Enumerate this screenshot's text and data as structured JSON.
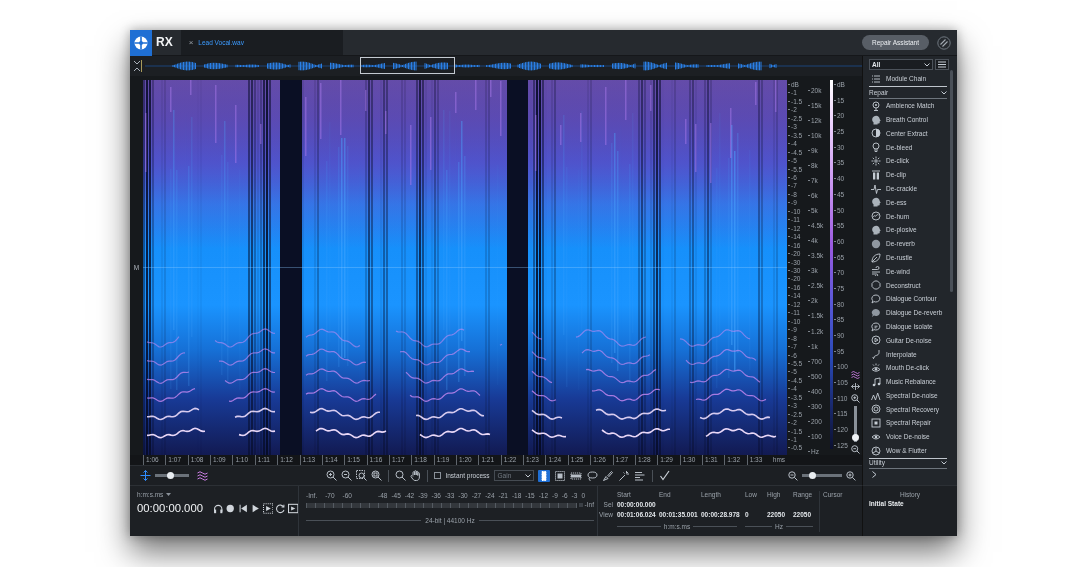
{
  "app": {
    "logo_text": "RX"
  },
  "file_tab": {
    "close_glyph": "×",
    "title": "Lead Vocal.wav",
    "selected": true
  },
  "repair_assistant": {
    "label": "Repair Assistant"
  },
  "spectrogram": {
    "channel_label": "M",
    "amplitude_scale": [
      "dB",
      "-1",
      "-1.5",
      "-2",
      "-2.5",
      "-3",
      "-3.5",
      "-4",
      "-4.5",
      "-5",
      "-5.5",
      "-6",
      "-7",
      "-8",
      "-9",
      "-10",
      "-11",
      "-12",
      "-14",
      "-16",
      "-20",
      "-30",
      "-30",
      "-20",
      "-16",
      "-14",
      "-12",
      "-11",
      "-10",
      "-9",
      "-8",
      "-7",
      "-6",
      "-5.5",
      "-5",
      "-4.5",
      "-4",
      "-3.5",
      "-3",
      "-2.5",
      "-2",
      "-1.5",
      "-1",
      "-0.5"
    ],
    "frequency_scale": [
      "20k",
      "15k",
      "12k",
      "10k",
      "9k",
      "8k",
      "7k",
      "6k",
      "5k",
      "4.5k",
      "4k",
      "3.5k",
      "3k",
      "2.5k",
      "2k",
      "1.5k",
      "1.2k",
      "1k",
      "700",
      "500",
      "400",
      "300",
      "200",
      "100",
      "Hz"
    ],
    "color_scale": [
      "dB",
      "15",
      "20",
      "25",
      "30",
      "35",
      "40",
      "45",
      "50",
      "55",
      "60",
      "65",
      "70",
      "75",
      "80",
      "85",
      "90",
      "95",
      "100",
      "105",
      "110",
      "115",
      "120",
      "125"
    ],
    "time_axis": [
      "1:06",
      "1:07",
      "1:08",
      "1:09",
      "1:10",
      "1:11",
      "1:12",
      "1:13",
      "1:14",
      "1:15",
      "1:16",
      "1:17",
      "1:18",
      "1:19",
      "1:20",
      "1:21",
      "1:22",
      "1:23",
      "1:24",
      "1:25",
      "1:26",
      "1:27",
      "1:28",
      "1:29",
      "1:30",
      "1:31",
      "1:32",
      "1:33"
    ],
    "time_unit": "hms"
  },
  "view_controls": {
    "display_slider": {
      "level": 0.45
    },
    "vertical_zoom": {
      "level": 0.02
    },
    "horizontal_zoom": {
      "level": 0.2
    }
  },
  "toolbar": {
    "instant_process": {
      "label": "Instant process",
      "checked": false
    },
    "process_mode": {
      "value": "Gain",
      "disabled": true
    },
    "tools": [
      {
        "selected": true
      },
      {
        "selected": false
      },
      {
        "selected": false
      },
      {
        "selected": false
      },
      {
        "selected": false
      },
      {
        "selected": false
      },
      {
        "selected": false
      }
    ]
  },
  "transport": {
    "time_format": "h:m:s.ms",
    "time": "00:00:00.000"
  },
  "meter": {
    "scale": [
      "-Inf.",
      "-70",
      "-60",
      "-48",
      "-45",
      "-42",
      "-39",
      "-36",
      "-33",
      "-30",
      "-27",
      "-24",
      "-21",
      "-18",
      "-15",
      "-12",
      "-9",
      "-6",
      "-3",
      "0"
    ],
    "end_label": "-Inf",
    "format": "24-bit | 44100 Hz"
  },
  "selection_info": {
    "columns": [
      "Start",
      "End",
      "Length",
      "Low",
      "High",
      "Range",
      "Cursor"
    ],
    "rows": [
      {
        "label": "Sel",
        "cells": [
          "00:00:00.000"
        ]
      },
      {
        "label": "View",
        "cells": [
          "00:01:06.024",
          "00:01:35.001",
          "00:00:28.978",
          "0",
          "22050",
          "22050"
        ]
      }
    ],
    "units": [
      "h:m:s.ms",
      "Hz"
    ]
  },
  "module_panel": {
    "filter": "All",
    "module_chain": "Module Chain",
    "groups": [
      {
        "title": "Repair",
        "modules": [
          "Ambience Match",
          "Breath Control",
          "Center Extract",
          "De-bleed",
          "De-click",
          "De-clip",
          "De-crackle",
          "De-ess",
          "De-hum",
          "De-plosive",
          "De-reverb",
          "De-rustle",
          "De-wind",
          "Deconstruct",
          "Dialogue Contour",
          "Dialogue De-reverb",
          "Dialogue Isolate",
          "Guitar De-noise",
          "Interpolate",
          "Mouth De-click",
          "Music Rebalance",
          "Spectral De-noise",
          "Spectral Recovery",
          "Spectral Repair",
          "Voice De-noise",
          "Wow & Flutter"
        ]
      },
      {
        "title": "Utility"
      }
    ]
  },
  "history": {
    "title": "History",
    "items": [
      "Initial State"
    ]
  }
}
